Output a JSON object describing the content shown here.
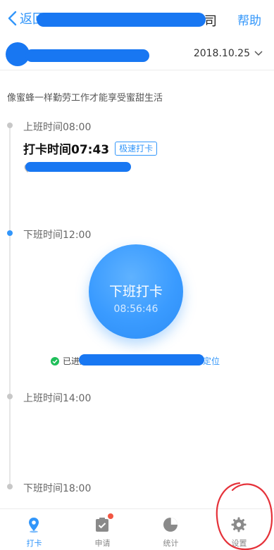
{
  "nav": {
    "back_label": "返回",
    "title_visible": "司",
    "help_label": "帮助"
  },
  "header": {
    "date": "2018.10.25"
  },
  "motto": "像蜜蜂一样勤劳工作才能享受蜜甜生活",
  "timeline": {
    "slot1": {
      "label": "上班时间08:00",
      "clock_text": "打卡时间07:43",
      "badge": "极速打卡"
    },
    "slot2": {
      "label": "下班时间12:00",
      "button_label": "下班打卡",
      "button_time": "08:56:46",
      "status_prefix": "已进入",
      "status_suffix": "定位"
    },
    "slot3": {
      "label": "上班时间14:00"
    },
    "slot4": {
      "label": "下班时间18:00"
    }
  },
  "tabbar": {
    "items": [
      {
        "label": "打卡",
        "icon": "location-pin-icon",
        "active": true
      },
      {
        "label": "申请",
        "icon": "clipboard-check-icon",
        "badge": true
      },
      {
        "label": "统计",
        "icon": "pie-chart-icon"
      },
      {
        "label": "设置",
        "icon": "gear-icon"
      }
    ]
  },
  "colors": {
    "accent": "#3296fa",
    "badge": "#f25643",
    "success": "#1fbf5a",
    "annotation": "#e5323a"
  }
}
